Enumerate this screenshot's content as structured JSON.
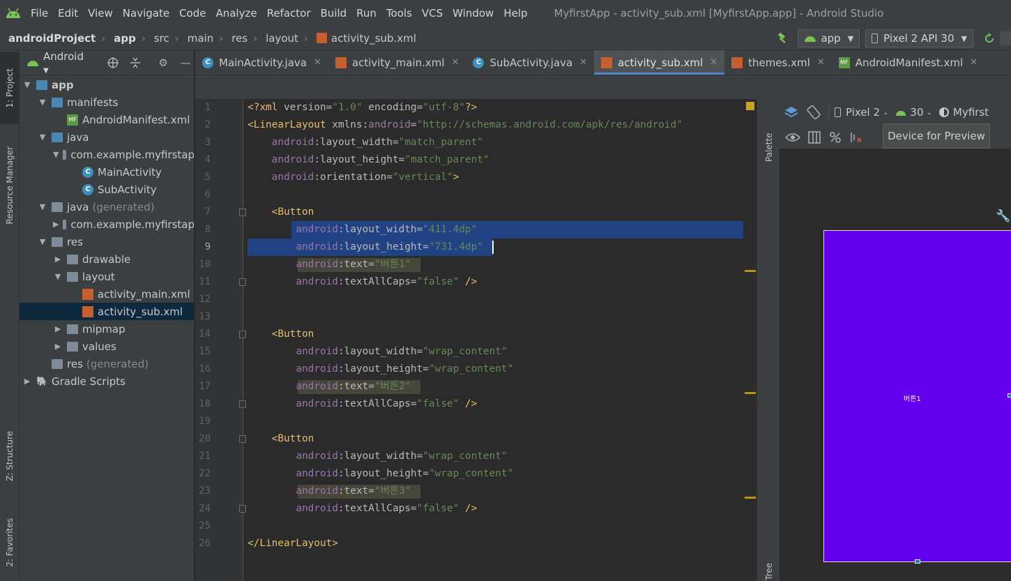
{
  "window": {
    "title": "MyfirstApp - activity_sub.xml [MyfirstApp.app] - Android Studio",
    "menu": [
      "File",
      "Edit",
      "View",
      "Navigate",
      "Code",
      "Analyze",
      "Refactor",
      "Build",
      "Run",
      "Tools",
      "VCS",
      "Window",
      "Help"
    ]
  },
  "breadcrumb": {
    "items": [
      "androidProject",
      "app",
      "src",
      "main",
      "res",
      "layout",
      "activity_sub.xml"
    ],
    "run_config": "app",
    "device": "Pixel 2 API 30"
  },
  "left_strip": {
    "project": "1: Project",
    "resource_manager": "Resource Manager",
    "structure": "Z: Structure",
    "favorites": "2: Favorites"
  },
  "project_panel": {
    "view": "Android",
    "tree": [
      {
        "label": "app",
        "level": 0,
        "icon": "module-folder",
        "expanded": true
      },
      {
        "label": "manifests",
        "level": 1,
        "icon": "folder",
        "expanded": true
      },
      {
        "label": "AndroidManifest.xml",
        "level": 2,
        "icon": "manifest-file"
      },
      {
        "label": "java",
        "level": 1,
        "icon": "folder",
        "expanded": true
      },
      {
        "label": "com.example.myfirstap",
        "level": 2,
        "icon": "package",
        "expanded": true
      },
      {
        "label": "MainActivity",
        "level": 3,
        "icon": "class"
      },
      {
        "label": "SubActivity",
        "level": 3,
        "icon": "class"
      },
      {
        "label": "java",
        "suffix": "(generated)",
        "level": 1,
        "icon": "generated-folder",
        "expanded": true
      },
      {
        "label": "com.example.myfirstap",
        "level": 2,
        "icon": "package",
        "expanded": false
      },
      {
        "label": "res",
        "level": 1,
        "icon": "res-folder",
        "expanded": true
      },
      {
        "label": "drawable",
        "level": 2,
        "icon": "folder",
        "expanded": false
      },
      {
        "label": "layout",
        "level": 2,
        "icon": "folder",
        "expanded": true
      },
      {
        "label": "activity_main.xml",
        "level": 3,
        "icon": "layout-file"
      },
      {
        "label": "activity_sub.xml",
        "level": 3,
        "icon": "layout-file",
        "selected": true
      },
      {
        "label": "mipmap",
        "level": 2,
        "icon": "folder",
        "expanded": false
      },
      {
        "label": "values",
        "level": 2,
        "icon": "folder",
        "expanded": false
      },
      {
        "label": "res",
        "suffix": "(generated)",
        "level": 1,
        "icon": "res-folder"
      },
      {
        "label": "Gradle Scripts",
        "level": 0,
        "icon": "gradle",
        "expanded": false
      }
    ]
  },
  "editor_tabs": [
    {
      "label": "MainActivity.java",
      "icon": "class"
    },
    {
      "label": "activity_main.xml",
      "icon": "layout-file"
    },
    {
      "label": "SubActivity.java",
      "icon": "class"
    },
    {
      "label": "activity_sub.xml",
      "icon": "layout-file",
      "active": true
    },
    {
      "label": "themes.xml",
      "icon": "layout-file"
    },
    {
      "label": "AndroidManifest.xml",
      "icon": "manifest-file"
    }
  ],
  "code": {
    "current_line": 9,
    "lines": [
      [
        [
          "pi",
          "<?xml "
        ],
        [
          "attr",
          "version="
        ],
        [
          "val",
          "\"1.0\""
        ],
        [
          "attr",
          " encoding="
        ],
        [
          "val",
          "\"utf-8\""
        ],
        [
          "pi",
          "?>"
        ]
      ],
      [
        [
          "tag",
          "<LinearLayout "
        ],
        [
          "attr",
          "xmlns:"
        ],
        [
          "ns",
          "android"
        ],
        [
          "attr",
          "="
        ],
        [
          "val",
          "\"http://schemas.android.com/apk/res/android\""
        ]
      ],
      [
        [
          "attr",
          "    "
        ],
        [
          "ns",
          "android"
        ],
        [
          "attr",
          ":layout_width="
        ],
        [
          "val",
          "\"match_parent\""
        ]
      ],
      [
        [
          "attr",
          "    "
        ],
        [
          "ns",
          "android"
        ],
        [
          "attr",
          ":layout_height="
        ],
        [
          "val",
          "\"match_parent\""
        ]
      ],
      [
        [
          "attr",
          "    "
        ],
        [
          "ns",
          "android"
        ],
        [
          "attr",
          ":orientation="
        ],
        [
          "val",
          "\"vertical\""
        ],
        [
          "tag",
          ">"
        ]
      ],
      [],
      [
        [
          "attr",
          "    "
        ],
        [
          "tag",
          "<Button"
        ]
      ],
      [
        [
          "attr",
          "        "
        ],
        [
          "ns",
          "android"
        ],
        [
          "attr",
          ":layout_width="
        ],
        [
          "val",
          "\"411.4dp\""
        ]
      ],
      [
        [
          "attr",
          "        "
        ],
        [
          "ns",
          "android"
        ],
        [
          "attr",
          ":layout_height="
        ],
        [
          "val",
          "\"731.4dp\""
        ]
      ],
      [
        [
          "attr",
          "        "
        ],
        [
          "ns",
          "android"
        ],
        [
          "attr",
          ":text="
        ],
        [
          "val",
          "\"버튼1\""
        ]
      ],
      [
        [
          "attr",
          "        "
        ],
        [
          "ns",
          "android"
        ],
        [
          "attr",
          ":textAllCaps="
        ],
        [
          "val",
          "\"false\""
        ],
        [
          "tag",
          " />"
        ]
      ],
      [],
      [],
      [
        [
          "attr",
          "    "
        ],
        [
          "tag",
          "<Button"
        ]
      ],
      [
        [
          "attr",
          "        "
        ],
        [
          "ns",
          "android"
        ],
        [
          "attr",
          ":layout_width="
        ],
        [
          "val",
          "\"wrap_content\""
        ]
      ],
      [
        [
          "attr",
          "        "
        ],
        [
          "ns",
          "android"
        ],
        [
          "attr",
          ":layout_height="
        ],
        [
          "val",
          "\"wrap_content\""
        ]
      ],
      [
        [
          "attr",
          "        "
        ],
        [
          "ns",
          "android"
        ],
        [
          "attr",
          ":text="
        ],
        [
          "val",
          "\"버튼2\""
        ]
      ],
      [
        [
          "attr",
          "        "
        ],
        [
          "ns",
          "android"
        ],
        [
          "attr",
          ":textAllCaps="
        ],
        [
          "val",
          "\"false\""
        ],
        [
          "tag",
          " />"
        ]
      ],
      [],
      [
        [
          "attr",
          "    "
        ],
        [
          "tag",
          "<Button"
        ]
      ],
      [
        [
          "attr",
          "        "
        ],
        [
          "ns",
          "android"
        ],
        [
          "attr",
          ":layout_width="
        ],
        [
          "val",
          "\"wrap_content\""
        ]
      ],
      [
        [
          "attr",
          "        "
        ],
        [
          "ns",
          "android"
        ],
        [
          "attr",
          ":layout_height="
        ],
        [
          "val",
          "\"wrap_content\""
        ]
      ],
      [
        [
          "attr",
          "        "
        ],
        [
          "ns",
          "android"
        ],
        [
          "attr",
          ":text="
        ],
        [
          "val",
          "\"버튼3\""
        ]
      ],
      [
        [
          "attr",
          "        "
        ],
        [
          "ns",
          "android"
        ],
        [
          "attr",
          ":textAllCaps="
        ],
        [
          "val",
          "\"false\""
        ],
        [
          "tag",
          " />"
        ]
      ],
      [],
      [
        [
          "tag",
          "</LinearLayout>"
        ]
      ]
    ]
  },
  "design_panel": {
    "palette_label": "Palette",
    "tree_label": "Tree",
    "device": "Pixel 2",
    "api": "30",
    "theme": "Myfirst",
    "tooltip": "Device for Preview",
    "preview_button_text": "버튼1",
    "preview_color": "#6200ee"
  },
  "colors": {
    "accent": "#4a88c7",
    "android_green": "#78c257",
    "selection": "#214283"
  }
}
